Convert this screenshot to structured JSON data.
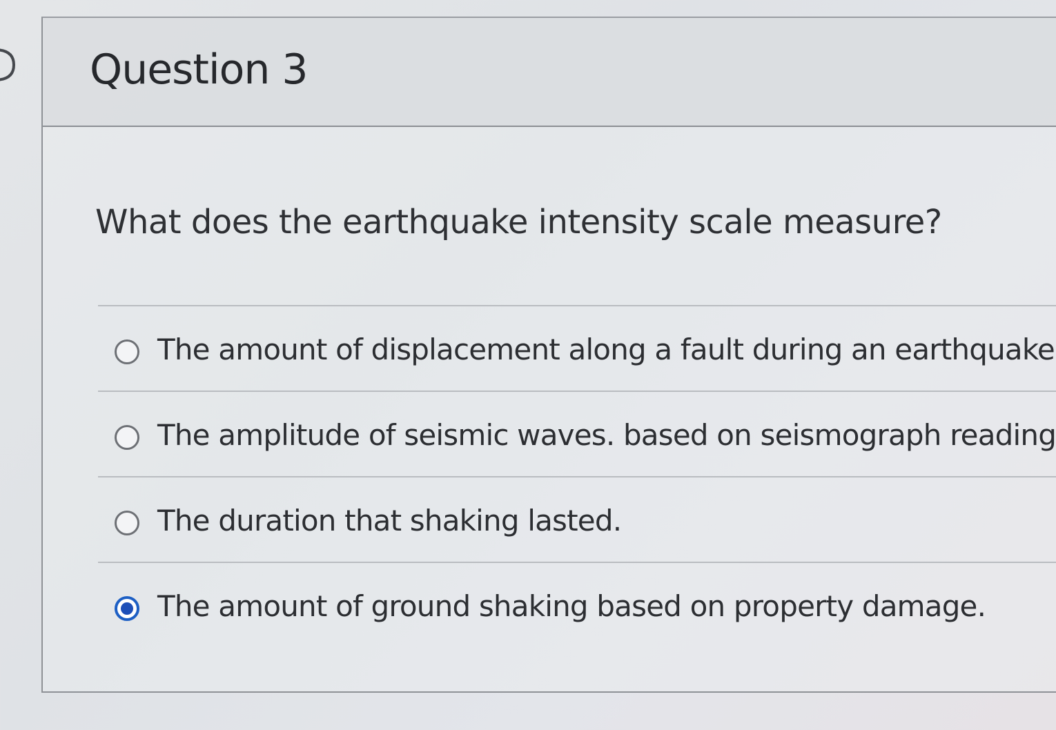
{
  "question": {
    "title": "Question 3",
    "text": "What does the earthquake intensity scale measure?",
    "answers": [
      {
        "label": "The amount of displacement along a fault during an earthquake.",
        "selected": false
      },
      {
        "label": "The amplitude of seismic waves. based on seismograph readings.",
        "selected": false
      },
      {
        "label": "The duration that shaking lasted.",
        "selected": false
      },
      {
        "label": "The amount of ground shaking based on property damage.",
        "selected": true
      }
    ]
  },
  "colors": {
    "selected_radio": "#1d4fb8",
    "unselected_radio_border": "#6d7075",
    "text": "#2c2e32"
  },
  "icons": {
    "collapse_toggle": "chevron-right-icon"
  }
}
